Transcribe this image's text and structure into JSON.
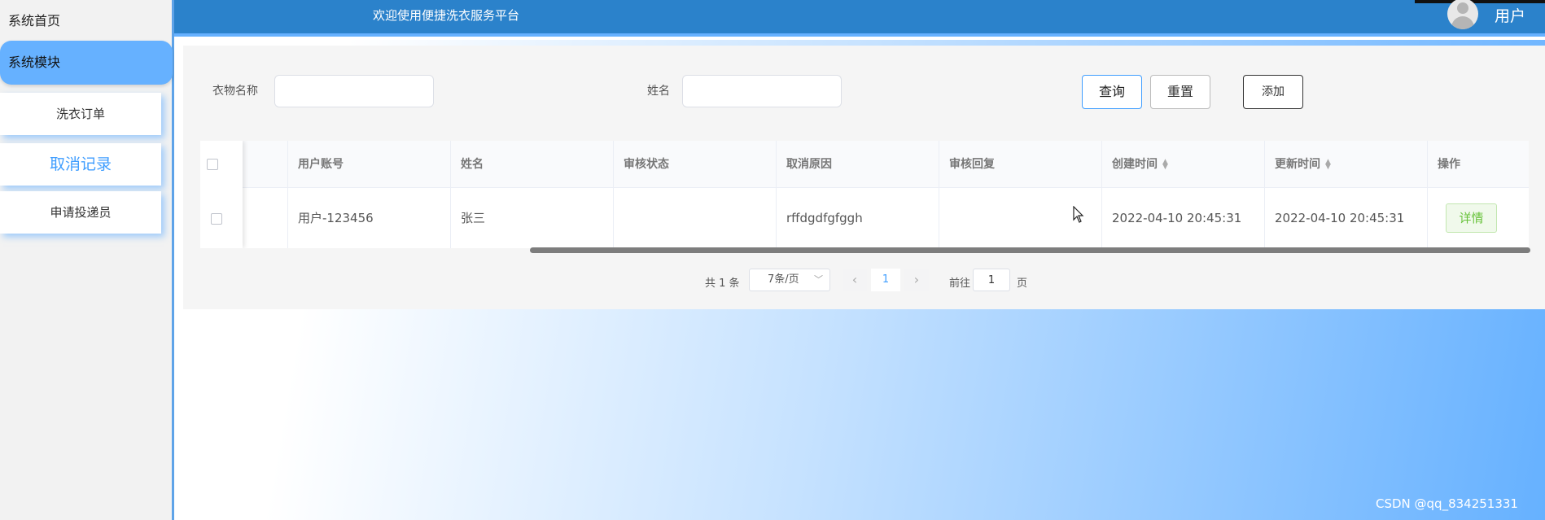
{
  "sidebar": {
    "home_label": "系统首页",
    "module_label": "系统模块",
    "items": [
      {
        "label": "洗衣订单"
      },
      {
        "label": "取消记录"
      },
      {
        "label": "申请投递员"
      }
    ]
  },
  "header": {
    "title": "欢迎使用便捷洗衣服务平台",
    "user_label": "用户",
    "avatar_icon": "user-avatar-icon"
  },
  "search": {
    "cloth_name_label": "衣物名称",
    "cloth_name_value": "",
    "name_label": "姓名",
    "name_value": "",
    "query_label": "查询",
    "reset_label": "重置",
    "add_label": "添加"
  },
  "table": {
    "columns": [
      "用户账号",
      "姓名",
      "审核状态",
      "取消原因",
      "审核回复",
      "创建时间",
      "更新时间",
      "操作"
    ],
    "rows": [
      {
        "account": "用户-123456",
        "name": "张三",
        "status": "",
        "reason": "rffdgdfgfggh",
        "reply": "",
        "created": "2022-04-10 20:45:31",
        "updated": "2022-04-10 20:45:31",
        "action_label": "详情"
      }
    ]
  },
  "pagination": {
    "total_text": "共 1 条",
    "page_size": "7条/页",
    "current_page": "1",
    "goto_label": "前往",
    "goto_value": "1",
    "page_unit": "页"
  },
  "watermark": "CSDN @qq_834251331",
  "colors": {
    "header_blue": "#2b82cb",
    "accent": "#409eff",
    "sidebar_active": "#66b1ff",
    "success": "#67c23a"
  }
}
